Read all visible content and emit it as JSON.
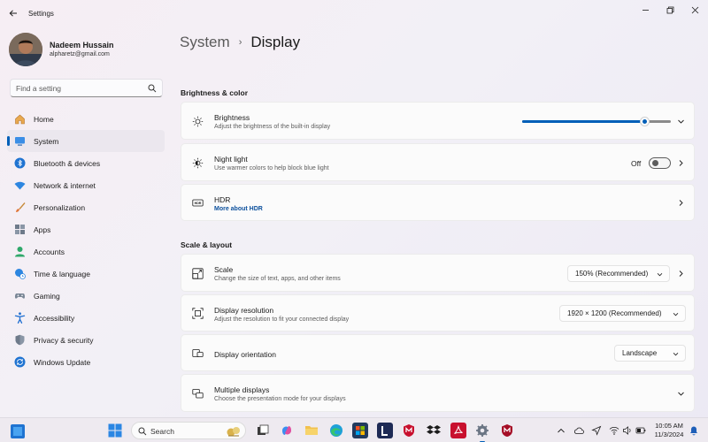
{
  "window": {
    "app_title": "Settings"
  },
  "profile": {
    "name": "Nadeem Hussain",
    "email": "alpharetz@gmail.com"
  },
  "search": {
    "placeholder": "Find a setting"
  },
  "sidebar": {
    "items": [
      {
        "label": "Home",
        "icon": "home-icon"
      },
      {
        "label": "System",
        "icon": "system-icon",
        "active": true
      },
      {
        "label": "Bluetooth & devices",
        "icon": "bluetooth-icon"
      },
      {
        "label": "Network & internet",
        "icon": "wifi-icon"
      },
      {
        "label": "Personalization",
        "icon": "brush-icon"
      },
      {
        "label": "Apps",
        "icon": "apps-icon"
      },
      {
        "label": "Accounts",
        "icon": "account-icon"
      },
      {
        "label": "Time & language",
        "icon": "globe-clock-icon"
      },
      {
        "label": "Gaming",
        "icon": "gamepad-icon"
      },
      {
        "label": "Accessibility",
        "icon": "accessibility-icon"
      },
      {
        "label": "Privacy & security",
        "icon": "shield-icon"
      },
      {
        "label": "Windows Update",
        "icon": "update-icon"
      }
    ]
  },
  "breadcrumb": {
    "parent": "System",
    "separator": "›",
    "current": "Display"
  },
  "sections": {
    "brightness_color": "Brightness & color",
    "scale_layout": "Scale & layout"
  },
  "cards": {
    "brightness": {
      "title": "Brightness",
      "subtitle": "Adjust the brightness of the built-in display",
      "level": 0.82
    },
    "night_light": {
      "title": "Night light",
      "subtitle": "Use warmer colors to help block blue light",
      "state": "Off"
    },
    "hdr": {
      "title": "HDR",
      "link": "More about HDR"
    },
    "scale": {
      "title": "Scale",
      "subtitle": "Change the size of text, apps, and other items",
      "value": "150% (Recommended)"
    },
    "resolution": {
      "title": "Display resolution",
      "subtitle": "Adjust the resolution to fit your connected display",
      "value": "1920 × 1200 (Recommended)"
    },
    "orientation": {
      "title": "Display orientation",
      "value": "Landscape"
    },
    "multiple": {
      "title": "Multiple displays",
      "subtitle": "Choose the presentation mode for your displays"
    }
  },
  "taskbar": {
    "search_label": "Search",
    "time": "10:05 AM",
    "date": "11/3/2024"
  },
  "colors": {
    "accent": "#005fb8"
  }
}
